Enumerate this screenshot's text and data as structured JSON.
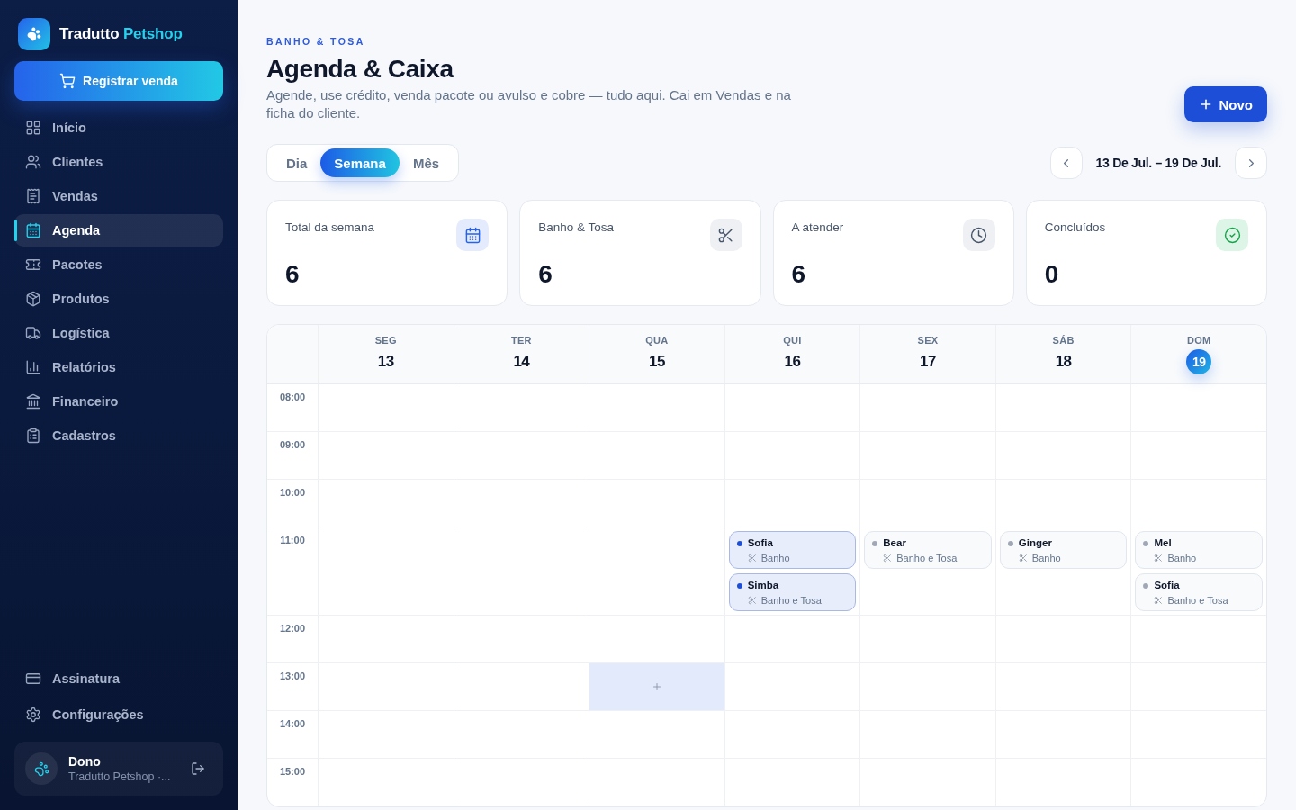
{
  "sidebar": {
    "brand": {
      "name": "Tradutto",
      "highlight": "Petshop"
    },
    "primary_action": {
      "label": "Registrar venda"
    },
    "nav": [
      {
        "label": "Início",
        "selected": false
      },
      {
        "label": "Clientes",
        "selected": false
      },
      {
        "label": "Vendas",
        "selected": false
      },
      {
        "label": "Agenda",
        "selected": true
      },
      {
        "label": "Pacotes",
        "selected": false
      },
      {
        "label": "Produtos",
        "selected": false
      },
      {
        "label": "Logística",
        "selected": false
      },
      {
        "label": "Relatórios",
        "selected": false
      },
      {
        "label": "Financeiro",
        "selected": false
      },
      {
        "label": "Cadastros",
        "selected": false
      }
    ],
    "footer_nav": [
      {
        "label": "Assinatura",
        "selected": false
      },
      {
        "label": "Configurações",
        "selected": false
      }
    ],
    "account": {
      "name": "Dono",
      "subtitle": "Tradutto Petshop ·..."
    }
  },
  "header": {
    "eyebrow": "BANHO & TOSA",
    "title": "Agenda & Caixa",
    "subtitle": "Agende, use crédito, venda pacote ou avulso e cobre — tudo aqui. Cai em Vendas e na ficha do cliente.",
    "new_button": "Novo"
  },
  "view_tabs": [
    {
      "label": "Dia",
      "selected": false
    },
    {
      "label": "Semana",
      "selected": true
    },
    {
      "label": "Mês",
      "selected": false
    }
  ],
  "date_range": "13 De Jul. – 19 De Jul.",
  "stats": [
    {
      "label": "Total da semana",
      "value": "6"
    },
    {
      "label": "Banho & Tosa",
      "value": "6"
    },
    {
      "label": "A atender",
      "value": "6"
    },
    {
      "label": "Concluídos",
      "value": "0"
    }
  ],
  "calendar": {
    "days": [
      {
        "weekday": "SEG",
        "date": "13",
        "today": false
      },
      {
        "weekday": "TER",
        "date": "14",
        "today": false
      },
      {
        "weekday": "QUA",
        "date": "15",
        "today": false
      },
      {
        "weekday": "QUI",
        "date": "16",
        "today": false
      },
      {
        "weekday": "SEX",
        "date": "17",
        "today": false
      },
      {
        "weekday": "SÁB",
        "date": "18",
        "today": false
      },
      {
        "weekday": "DOM",
        "date": "19",
        "today": true
      }
    ],
    "rows": [
      {
        "time": "08:00",
        "cells": [
          {
            "highlighted": false
          },
          {
            "highlighted": false
          },
          {
            "highlighted": false
          },
          {
            "highlighted": false
          },
          {
            "highlighted": false
          },
          {
            "highlighted": false
          },
          {
            "highlighted": false
          }
        ]
      },
      {
        "time": "09:00",
        "cells": [
          {
            "highlighted": false
          },
          {
            "highlighted": false
          },
          {
            "highlighted": false
          },
          {
            "highlighted": false
          },
          {
            "highlighted": false
          },
          {
            "highlighted": false
          },
          {
            "highlighted": false
          }
        ]
      },
      {
        "time": "10:00",
        "cells": [
          {
            "highlighted": false
          },
          {
            "highlighted": false
          },
          {
            "highlighted": false
          },
          {
            "highlighted": false
          },
          {
            "highlighted": false
          },
          {
            "highlighted": false
          },
          {
            "highlighted": false
          }
        ]
      },
      {
        "time": "11:00",
        "cells": [
          {
            "highlighted": false
          },
          {
            "highlighted": false
          },
          {
            "highlighted": false
          },
          {
            "highlighted": false,
            "events": [
              {
                "pet": "Sofia",
                "service": "Banho",
                "confirmed": true
              },
              {
                "pet": "Simba",
                "service": "Banho e Tosa",
                "confirmed": true
              }
            ]
          },
          {
            "highlighted": false,
            "events": [
              {
                "pet": "Bear",
                "service": "Banho e Tosa",
                "confirmed": false
              }
            ]
          },
          {
            "highlighted": false,
            "events": [
              {
                "pet": "Ginger",
                "service": "Banho",
                "confirmed": false
              }
            ]
          },
          {
            "highlighted": false,
            "events": [
              {
                "pet": "Mel",
                "service": "Banho",
                "confirmed": false
              },
              {
                "pet": "Sofia",
                "service": "Banho e Tosa",
                "confirmed": false
              }
            ]
          }
        ]
      },
      {
        "time": "12:00",
        "cells": [
          {
            "highlighted": false
          },
          {
            "highlighted": false
          },
          {
            "highlighted": false
          },
          {
            "highlighted": false
          },
          {
            "highlighted": false
          },
          {
            "highlighted": false
          },
          {
            "highlighted": false
          }
        ]
      },
      {
        "time": "13:00",
        "cells": [
          {
            "highlighted": false
          },
          {
            "highlighted": false
          },
          {
            "highlighted": true
          },
          {
            "highlighted": false
          },
          {
            "highlighted": false
          },
          {
            "highlighted": false
          },
          {
            "highlighted": false
          }
        ]
      },
      {
        "time": "14:00",
        "cells": [
          {
            "highlighted": false
          },
          {
            "highlighted": false
          },
          {
            "highlighted": false
          },
          {
            "highlighted": false
          },
          {
            "highlighted": false
          },
          {
            "highlighted": false
          },
          {
            "highlighted": false
          }
        ]
      },
      {
        "time": "15:00",
        "cells": [
          {
            "highlighted": false
          },
          {
            "highlighted": false
          },
          {
            "highlighted": false
          },
          {
            "highlighted": false
          },
          {
            "highlighted": false
          },
          {
            "highlighted": false
          },
          {
            "highlighted": false
          }
        ]
      }
    ]
  }
}
